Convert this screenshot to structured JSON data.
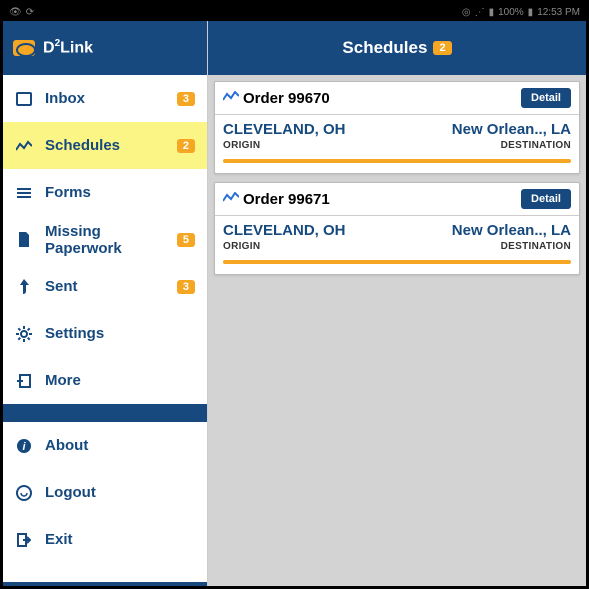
{
  "statusbar": {
    "battery": "100%",
    "time": "12:53 PM"
  },
  "brand": {
    "name_pre": "D",
    "name_sup": "2",
    "name_post": "Link"
  },
  "sidebar": {
    "items": [
      {
        "label": "Inbox",
        "badge": "3"
      },
      {
        "label": "Schedules",
        "badge": "2"
      },
      {
        "label": "Forms"
      },
      {
        "label": "Missing Paperwork",
        "badge": "5"
      },
      {
        "label": "Sent",
        "badge": "3"
      },
      {
        "label": "Settings"
      },
      {
        "label": "More"
      }
    ],
    "secondary": [
      {
        "label": "About"
      },
      {
        "label": "Logout"
      },
      {
        "label": "Exit"
      }
    ]
  },
  "header": {
    "title": "Schedules",
    "badge": "2"
  },
  "orders": [
    {
      "title": "Order 99670",
      "detail": "Detail",
      "origin_city": "CLEVELAND, OH",
      "dest_city": "New Orlean.., LA",
      "origin_label": "ORIGIN",
      "dest_label": "DESTINATION"
    },
    {
      "title": "Order 99671",
      "detail": "Detail",
      "origin_city": "CLEVELAND, OH",
      "dest_city": "New Orlean.., LA",
      "origin_label": "ORIGIN",
      "dest_label": "DESTINATION"
    }
  ]
}
